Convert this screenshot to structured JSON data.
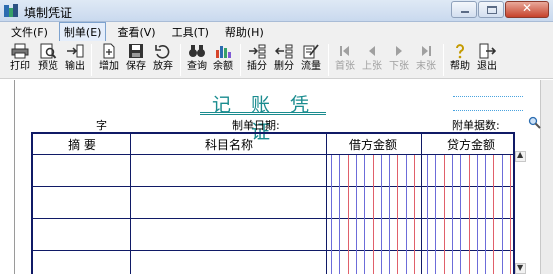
{
  "window": {
    "title": "填制凭证"
  },
  "menu": [
    "文件(F)",
    "制单(E)",
    "查看(V)",
    "工具(T)",
    "帮助(H)"
  ],
  "toolbar": [
    {
      "label": "打印",
      "icon": "printer-icon",
      "enabled": true
    },
    {
      "label": "预览",
      "icon": "preview-icon",
      "enabled": true
    },
    {
      "label": "输出",
      "icon": "export-icon",
      "enabled": true
    },
    {
      "label": "增加",
      "icon": "add-icon",
      "enabled": true
    },
    {
      "label": "保存",
      "icon": "save-icon",
      "enabled": true
    },
    {
      "label": "放弃",
      "icon": "undo-icon",
      "enabled": true
    },
    {
      "label": "查询",
      "icon": "binoculars-icon",
      "enabled": true
    },
    {
      "label": "余额",
      "icon": "bar-chart-icon",
      "enabled": true
    },
    {
      "label": "插分",
      "icon": "insert-row-icon",
      "enabled": true
    },
    {
      "label": "删分",
      "icon": "delete-row-icon",
      "enabled": true
    },
    {
      "label": "流量",
      "icon": "flow-icon",
      "enabled": true
    },
    {
      "label": "首张",
      "icon": "first-icon",
      "enabled": false
    },
    {
      "label": "上张",
      "icon": "prev-icon",
      "enabled": false
    },
    {
      "label": "下张",
      "icon": "next-icon",
      "enabled": false
    },
    {
      "label": "末张",
      "icon": "last-icon",
      "enabled": false
    },
    {
      "label": "帮助",
      "icon": "help-icon",
      "enabled": true
    },
    {
      "label": "退出",
      "icon": "exit-icon",
      "enabled": true
    }
  ],
  "voucher": {
    "title": "记 账 凭 证",
    "zi_label": "字",
    "date_label": "制单日期:",
    "attach_label": "附单据数:",
    "columns": [
      "摘  要",
      "科目名称",
      "借方金额",
      "贷方金额"
    ]
  },
  "colors": {
    "accent": "#1a8c8f",
    "table_border": "#101a66",
    "amount_blue": "#6c6cd9",
    "amount_red": "#e0606a"
  }
}
